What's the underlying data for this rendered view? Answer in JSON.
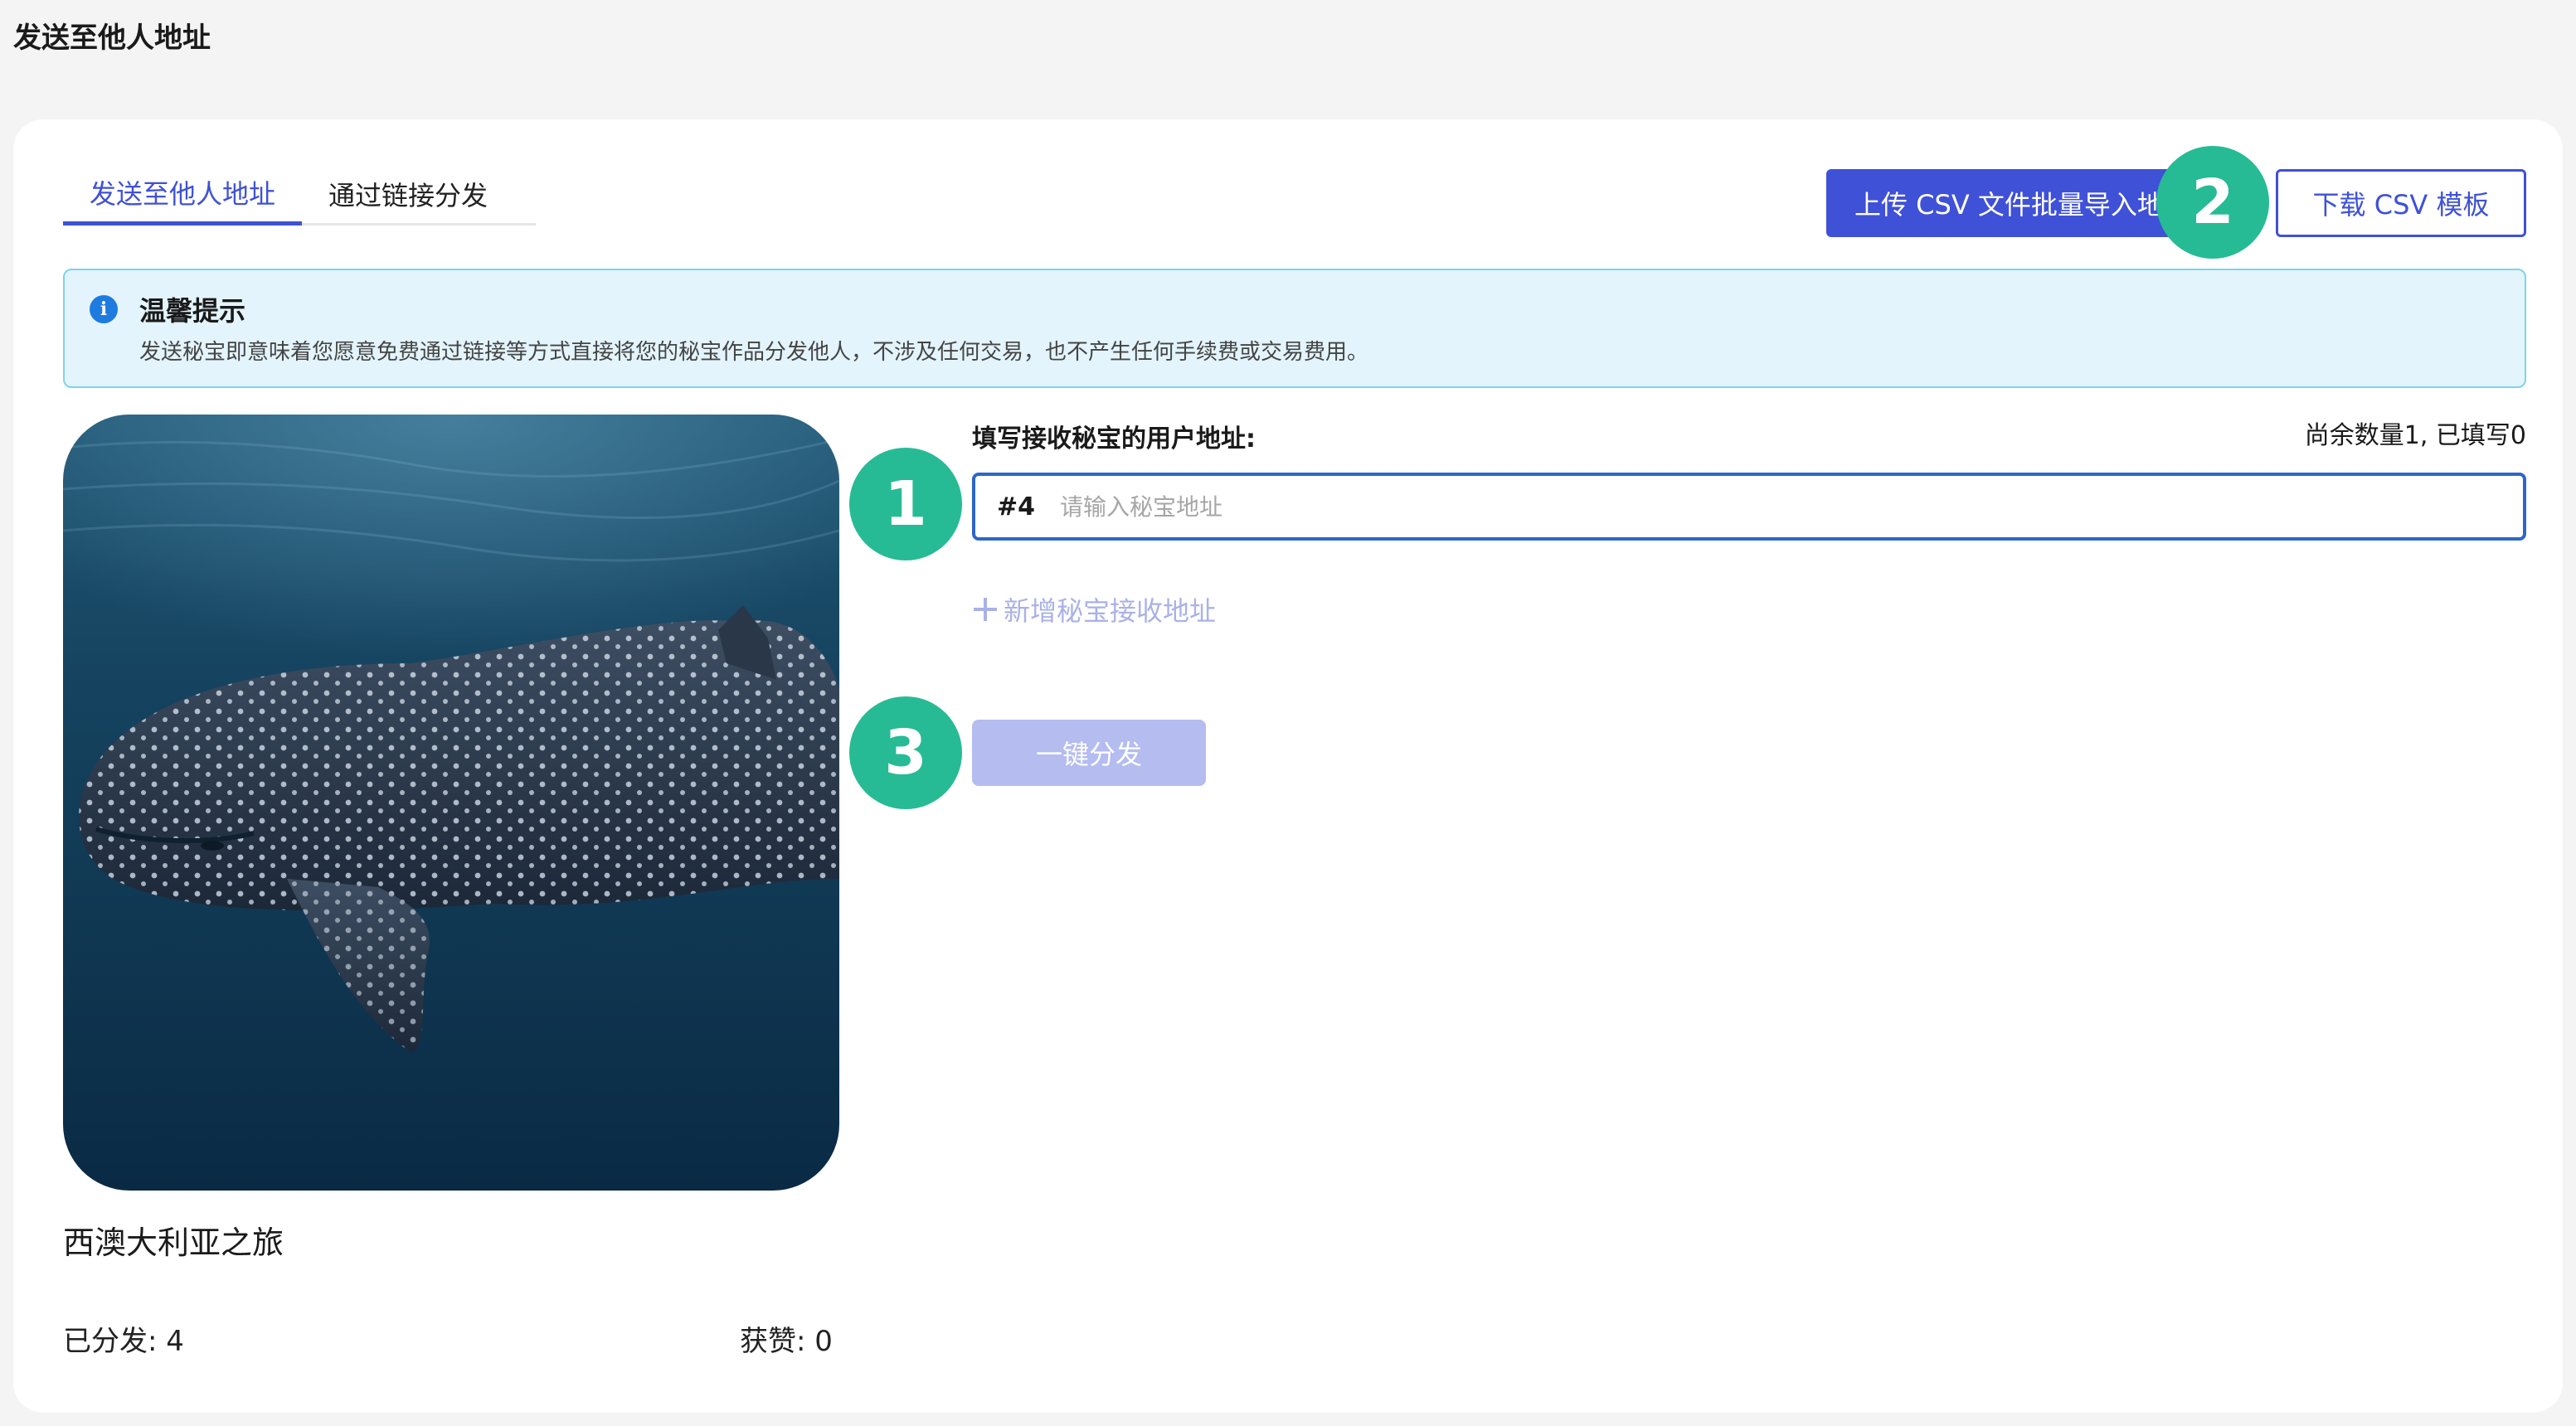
{
  "page": {
    "title": "发送至他人地址"
  },
  "tabs": [
    {
      "label": "发送至他人地址",
      "active": true
    },
    {
      "label": "通过链接分发",
      "active": false
    }
  ],
  "actions": {
    "upload_label": "上传 CSV 文件批量导入地址",
    "download_label": "下载 CSV 模板"
  },
  "notice": {
    "icon": "info-icon",
    "title": "温馨提示",
    "body": "发送秘宝即意味着您愿意免费通过链接等方式直接将您的秘宝作品分发他人，不涉及任何交易，也不产生任何手续费或交易费用。"
  },
  "artwork": {
    "name": "西澳大利亚之旅",
    "distributed": "已分发: 4",
    "likes": "获赞: 0"
  },
  "form": {
    "label": "填写接收秘宝的用户地址:",
    "remaining": "尚余数量1, 已填写0",
    "index": "#4",
    "value": "",
    "placeholder": "请输入秘宝地址",
    "add_label": "新增秘宝接收地址",
    "submit_label": "一键分发"
  },
  "steps": [
    "1",
    "2",
    "3"
  ],
  "colors": {
    "accent": "#3f51d6",
    "step_badge": "#26bb95",
    "notice_bg": "#e3f4fc",
    "disabled_button": "#b4bcf0"
  }
}
